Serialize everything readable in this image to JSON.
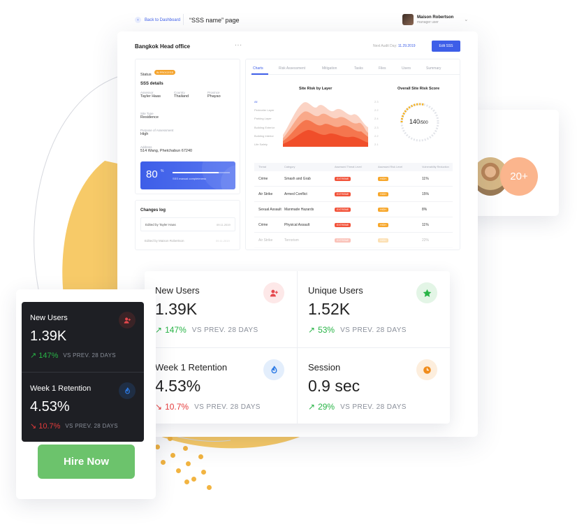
{
  "header": {
    "back_label": "Back to Dashboard",
    "page_title": "“SSS name” page",
    "user_name": "Maison Robertson",
    "user_role": "manager user"
  },
  "office": {
    "name": "Bangkok Head office",
    "more": "···",
    "audit_label": "Next Audit Day:",
    "audit_date": "11.29.2019",
    "edit_label": "Edit SSS"
  },
  "sss": {
    "status_label": "Status",
    "status_value": "IN PROCESS",
    "section_title": "SSS details",
    "fields": [
      {
        "label": "Assessor",
        "value": "Tayler Haas"
      },
      {
        "label": "Country",
        "value": "Thailand"
      },
      {
        "label": "Province",
        "value": "Phayao"
      },
      {
        "label": "Site Type",
        "value": "Residence"
      },
      {
        "label": "Purpose of Assessment",
        "value": "High"
      },
      {
        "label": "Address",
        "value": "514 Wang, Phetchabun 67240"
      }
    ],
    "completeness_value": "80",
    "completeness_unit": "%",
    "completeness_fraction": 0.8,
    "completeness_label": "SSS manual completeness"
  },
  "changes": {
    "title": "Changes log",
    "items": [
      {
        "text": "Edited by Tayler Haas",
        "date": "09.11.2019"
      },
      {
        "text": "Edited by Maison Robertson",
        "date": "09.11.2019"
      }
    ]
  },
  "tabs": [
    "Charts",
    "Risk Assessment",
    "Mitigation",
    "Tasks",
    "Files",
    "Users",
    "Summary"
  ],
  "site_risk": {
    "title": "Site Risk by Layer",
    "layers": [
      "All",
      "Perimeter Layer",
      "Parking Layer",
      "Building Exterior",
      "Building Interior",
      "Life Safety"
    ],
    "scale": [
      "2.3",
      "2.2",
      "2.4",
      "2.3",
      "2.2",
      "2.1"
    ]
  },
  "overall": {
    "title": "Overall Site Risk Score",
    "score": "140",
    "max": "/500",
    "fraction": 0.28
  },
  "risk_table": {
    "headers": [
      "Threat",
      "Category",
      "Assessed Threat Level",
      "Assessed Risk Level",
      "Vulnerability Reduction"
    ],
    "rows": [
      {
        "threat": "Crime",
        "category": "Smash and Grab",
        "threat_level": "EXTREME",
        "risk_level": "HIGH",
        "reduction": "11%"
      },
      {
        "threat": "Air Strike",
        "category": "Armed Conflict",
        "threat_level": "EXTREME",
        "risk_level": "HIGH",
        "reduction": "15%"
      },
      {
        "threat": "Sexual Assault",
        "category": "Manmade Hazards",
        "threat_level": "EXTREME",
        "risk_level": "HIGH",
        "reduction": "8%"
      },
      {
        "threat": "Crime",
        "category": "Physical Assault",
        "threat_level": "EXTREME",
        "risk_level": "HIGH",
        "reduction": "11%"
      },
      {
        "threat": "Air Strike",
        "category": "Terrorism",
        "threat_level": "EXTREME",
        "risk_level": "HIGH",
        "reduction": "22%"
      }
    ]
  },
  "stats": [
    {
      "title": "New Users",
      "value": "1.39K",
      "delta": "147%",
      "trend": "up",
      "vs": "VS PREV. 28 DAYS",
      "icon": "add-user-icon",
      "icon_color": "#e5484d",
      "icon_bg": "#fde8e8"
    },
    {
      "title": "Unique Users",
      "value": "1.52K",
      "delta": "53%",
      "trend": "up",
      "vs": "VS PREV. 28 DAYS",
      "icon": "star-icon",
      "icon_color": "#28b446",
      "icon_bg": "#e3f5e6"
    },
    {
      "title": "Week 1 Retention",
      "value": "4.53%",
      "delta": "10.7%",
      "trend": "down",
      "vs": "VS PREV. 28 DAYS",
      "icon": "flame-icon",
      "icon_color": "#2d7be5",
      "icon_bg": "#e3eefc"
    },
    {
      "title": "Session",
      "value": "0.9 sec",
      "delta": "29%",
      "trend": "up",
      "vs": "VS PREV. 28 DAYS",
      "icon": "clock-icon",
      "icon_color": "#f08c1c",
      "icon_bg": "#fdeedd"
    }
  ],
  "dark_stats": [
    {
      "title": "New Users",
      "value": "1.39K",
      "delta": "147%",
      "trend": "up",
      "vs": "VS PREV. 28 DAYS",
      "icon": "add-user-icon"
    },
    {
      "title": "Week 1 Retention",
      "value": "4.53%",
      "delta": "10.7%",
      "trend": "down",
      "vs": "VS PREV. 28 DAYS",
      "icon": "flame-icon"
    }
  ],
  "hire_label": "Hire Now",
  "team": {
    "more_count": "20+"
  },
  "colors": {
    "accent": "#3d5ee8",
    "up": "#28b446",
    "down": "#e53b3b",
    "hire": "#6cc36c",
    "blob": "#f6c14e"
  }
}
